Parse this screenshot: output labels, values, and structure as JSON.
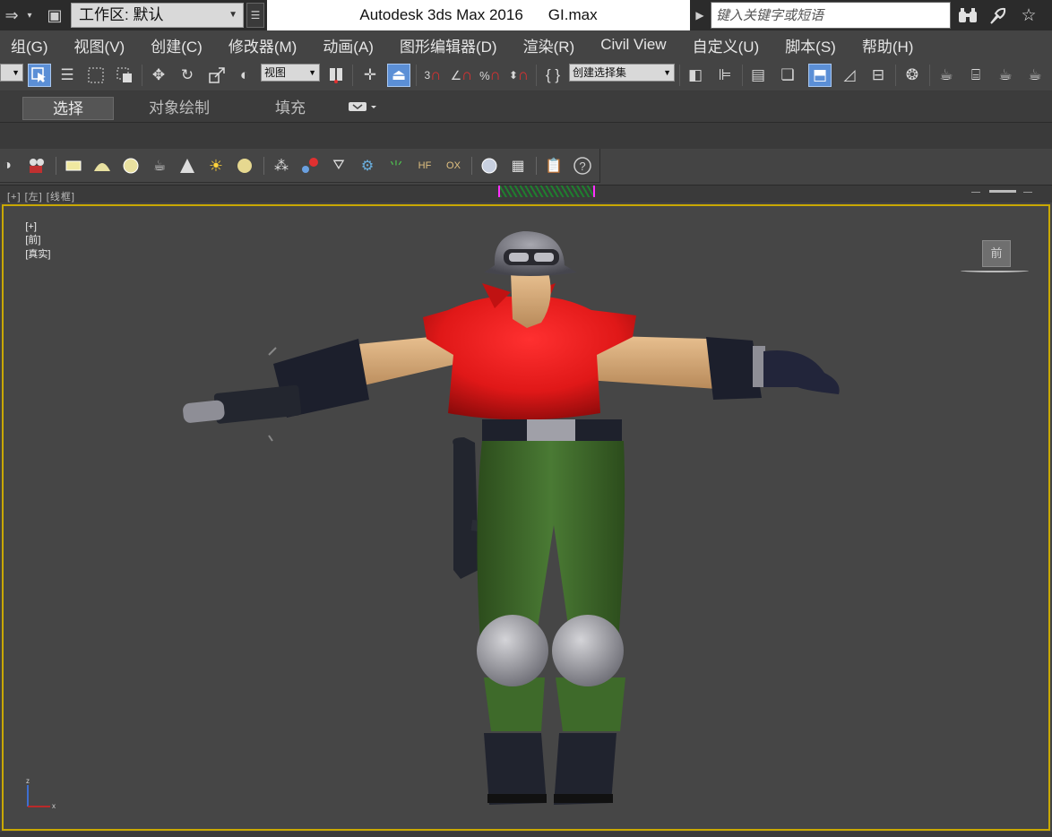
{
  "titlebar": {
    "workspace_label": "工作区: 默认",
    "app_title": "Autodesk 3ds Max 2016",
    "file_name": "GI.max",
    "search_placeholder": "键入关键字或短语"
  },
  "menu": {
    "items": [
      "组(G)",
      "视图(V)",
      "创建(C)",
      "修改器(M)",
      "动画(A)",
      "图形编辑器(D)",
      "渲染(R)",
      "Civil View",
      "自定义(U)",
      "脚本(S)",
      "帮助(H)"
    ]
  },
  "toolbar": {
    "ref_coord_value": "视图",
    "named_selection_value": "创建选择集",
    "snap_label": "3",
    "angle_snap_label": "",
    "percent_snap_label": "%"
  },
  "ribbon": {
    "tabs": [
      "选择",
      "对象绘制",
      "填充"
    ],
    "active_tab": "选择"
  },
  "viewports": {
    "top_label": "[+] [左] [线框]",
    "main_label_plus": "[+]",
    "main_label_view": "[前]",
    "main_label_shading": "[真实]",
    "viewcube_face": "前"
  },
  "axis": {
    "z_label": "z",
    "x_label": "x"
  },
  "colors": {
    "viewport_border": "#c9a800",
    "active_button": "#5b8fd6",
    "vest": "#e01818",
    "pants": "#3e6a2a",
    "skin": "#d8b080",
    "boots": "#20232e"
  }
}
